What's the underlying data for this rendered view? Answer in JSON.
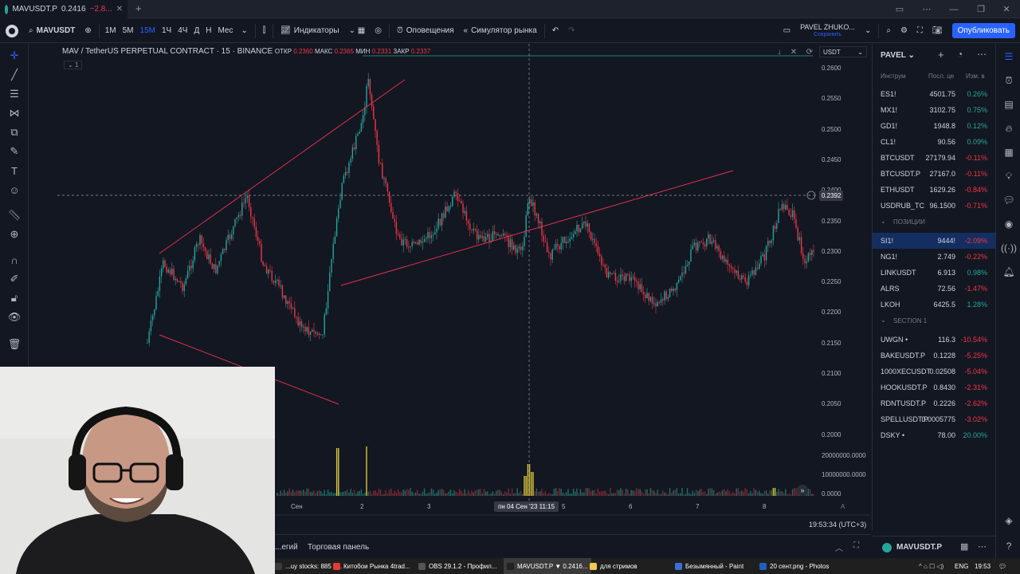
{
  "browser": {
    "tab_symbol": "MAVUSDT.P",
    "tab_price": "0.2416",
    "tab_change": "−2.8..."
  },
  "toolbar": {
    "symbol": "MAVUSDT",
    "intervals": [
      "1M",
      "5M",
      "15M",
      "1Ч",
      "4Ч",
      "Д",
      "Н",
      "Мес"
    ],
    "active_interval": "15M",
    "indicators": "Индикаторы",
    "alerts": "Оповещения",
    "simulator": "Симулятор рынка",
    "user": "PAVEL ZHUKO...",
    "saved": "Сохранить",
    "publish": "Опубликовать"
  },
  "legend": {
    "title": "MAV / TetherUS PERPETUAL CONTRACT · 15 · BINANCE",
    "open_label": "ОТКР",
    "open": "0.2360",
    "high_label": "МАКС",
    "high": "0.2365",
    "low_label": "МИН",
    "low": "0.2331",
    "close_label": "ЗАКР",
    "close": "0.2337",
    "sub": "1"
  },
  "currency_select": "USDT",
  "price_axis": [
    "0.2600",
    "0.2550",
    "0.2500",
    "0.2450",
    "0.2400",
    "0.2350",
    "0.2300",
    "0.2250",
    "0.2200",
    "0.2150",
    "0.2100",
    "0.2050",
    "0.2000"
  ],
  "current_price": "0.2392",
  "volume_axis": [
    "20000000.0000",
    "10000000.0000",
    "0.0000"
  ],
  "time_axis": [
    "Сен",
    "2",
    "3",
    "5",
    "6",
    "7",
    "8"
  ],
  "crosshair_time": "пн 04 Сен '23   11:15",
  "clock": "19:53:34 (UTC+3)",
  "bottom_tabs": [
    "...егий",
    "Торговая панель"
  ],
  "watchlist": {
    "name": "PAVEL",
    "headers": [
      "Инструм",
      "Посл. це",
      "Изм. в"
    ],
    "items": [
      {
        "sym": "ES1!",
        "price": "4501.75",
        "chg": "0.26%",
        "up": true
      },
      {
        "sym": "MX1!",
        "price": "3102.75",
        "chg": "0.75%",
        "up": true
      },
      {
        "sym": "GD1!",
        "price": "1948.8",
        "chg": "0.12%",
        "up": true
      },
      {
        "sym": "CL1!",
        "price": "90.56",
        "chg": "0.09%",
        "up": true
      },
      {
        "sym": "BTCUSDT",
        "price": "27179.94",
        "chg": "-0.11%",
        "up": false
      },
      {
        "sym": "BTCUSDT.P",
        "price": "27167.0",
        "chg": "-0.11%",
        "up": false
      },
      {
        "sym": "ETHUSDT",
        "price": "1629.26",
        "chg": "-0.84%",
        "up": false
      },
      {
        "sym": "USDRUB_TC",
        "price": "96.1500",
        "chg": "-0.71%",
        "up": false
      }
    ],
    "section1": "ПОЗИЦИИ",
    "items2": [
      {
        "sym": "SI1!",
        "price": "9444!",
        "chg": "-2.09%",
        "up": false,
        "sel": true
      },
      {
        "sym": "NG1!",
        "price": "2.749",
        "chg": "-0.22%",
        "up": false
      },
      {
        "sym": "LINKUSDT",
        "price": "6.913",
        "chg": "0.98%",
        "up": true
      },
      {
        "sym": "ALRS",
        "price": "72.56",
        "chg": "-1.47%",
        "up": false
      },
      {
        "sym": "LKOH",
        "price": "6425.5",
        "chg": "1.28%",
        "up": true
      }
    ],
    "section2": "SECTION 1",
    "items3": [
      {
        "sym": "UWGN •",
        "price": "116.3",
        "chg": "-10.54%",
        "up": false
      },
      {
        "sym": "BAKEUSDT.P",
        "price": "0.1228",
        "chg": "-5.25%",
        "up": false
      },
      {
        "sym": "1000XECUSDT",
        "price": "0.02508",
        "chg": "-5.04%",
        "up": false
      },
      {
        "sym": "HOOKUSDT.P",
        "price": "0.8430",
        "chg": "-2.31%",
        "up": false
      },
      {
        "sym": "RDNTUSDT.P",
        "price": "0.2226",
        "chg": "-2.62%",
        "up": false
      },
      {
        "sym": "SPELLUSDT.P",
        "price": "0.0005775",
        "chg": "-3.02%",
        "up": false
      },
      {
        "sym": "DSKY •",
        "price": "78.00",
        "chg": "20.00%",
        "up": true
      }
    ],
    "footer_symbol": "MAVUSDT.P"
  },
  "taskbar": [
    "...uy stocks: 885 и...",
    "Китобои Рынка 4trad...",
    "OBS 29.1.2 - Профил...",
    "MAVUSDT.P ▼ 0.2416...",
    "для стримов",
    "Безымянный - Paint",
    "20 сент.png - Photos"
  ],
  "tray": {
    "lang": "ENG",
    "time": "19:53"
  },
  "colors": {
    "bg": "#131722",
    "up": "#26a69a",
    "down": "#f23645",
    "accent": "#2962ff",
    "trend": "#e0304d"
  }
}
